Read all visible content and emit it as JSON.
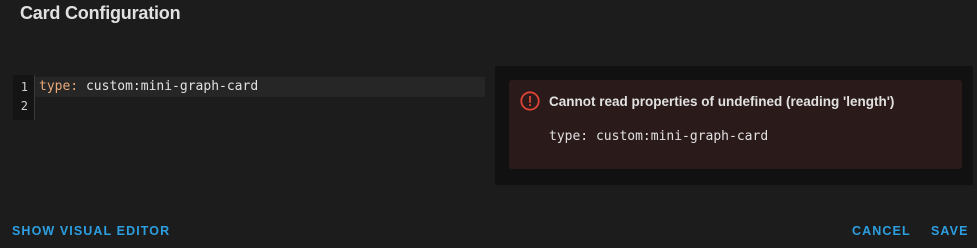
{
  "dialog": {
    "title": "Card Configuration"
  },
  "editor": {
    "lines": [
      {
        "number": "1",
        "key": "type:",
        "value": " custom:mini-graph-card"
      },
      {
        "number": "2",
        "key": "",
        "value": ""
      }
    ]
  },
  "preview": {
    "error_icon": "alert-circle-icon",
    "error_title": "Cannot read properties of undefined (reading 'length')",
    "error_detail": "type: custom:mini-graph-card"
  },
  "actions": {
    "show_visual_editor": "SHOW VISUAL EDITOR",
    "cancel": "CANCEL",
    "save": "SAVE"
  },
  "colors": {
    "background": "#1c1c1c",
    "accent": "#2d9ee0",
    "error": "#db4437",
    "error_card": "#2b1a1a",
    "yaml_key": "#e8a878"
  }
}
